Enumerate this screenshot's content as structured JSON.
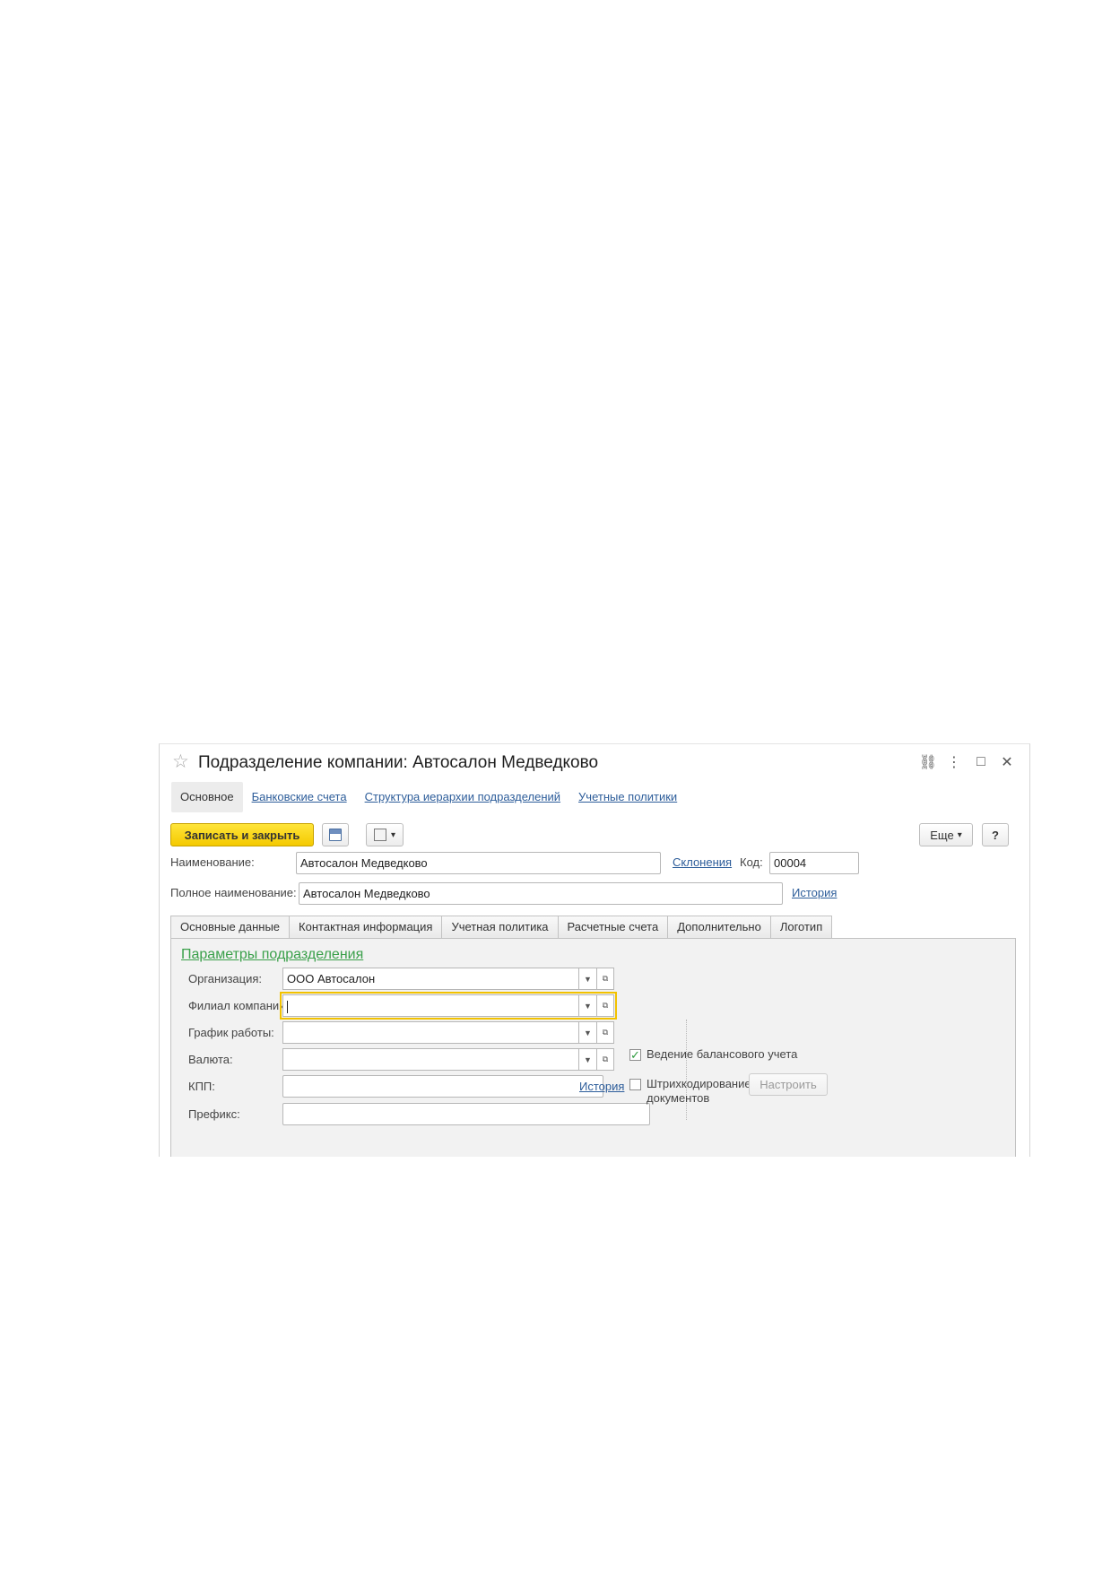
{
  "window": {
    "title": "Подразделение компании: Автосалон Медведково",
    "star_icon": "☆",
    "link_icon": "⛓",
    "more_icon": "⋮",
    "maximize_icon": "□",
    "close_icon": "✕"
  },
  "nav": {
    "items": [
      {
        "label": "Основное",
        "active": true
      },
      {
        "label": "Банковские счета",
        "active": false
      },
      {
        "label": "Структура иерархии подразделений",
        "active": false
      },
      {
        "label": "Учетные политики",
        "active": false
      }
    ]
  },
  "toolbar": {
    "save_close_label": "Записать и закрыть",
    "save_icon": "💾",
    "report_icon": "▣",
    "report_arrow": "▾",
    "more_label": "Еще",
    "more_arrow": "▾",
    "help_label": "?"
  },
  "header_fields": {
    "name_label": "Наименование:",
    "name_value": "Автосалон Медведково",
    "declension_link": "Склонения",
    "code_label": "Код:",
    "code_value": "00004",
    "fullname_label": "Полное наименование:",
    "fullname_value": "Автосалон Медведково",
    "history_link": "История"
  },
  "tabs": [
    {
      "label": "Основные данные",
      "active": true
    },
    {
      "label": "Контактная информация",
      "active": false
    },
    {
      "label": "Учетная политика",
      "active": false
    },
    {
      "label": "Расчетные счета",
      "active": false
    },
    {
      "label": "Дополнительно",
      "active": false
    },
    {
      "label": "Логотип",
      "active": false
    }
  ],
  "params": {
    "group_title": "Параметры подразделения",
    "org_label": "Организация:",
    "org_value": "ООО Автосалон",
    "branch_label": "Филиал компании:",
    "branch_value": "",
    "schedule_label": "График работы:",
    "schedule_value": "",
    "currency_label": "Валюта:",
    "currency_value": "",
    "kpp_label": "КПП:",
    "kpp_value": "",
    "kpp_history_link": "История",
    "prefix_label": "Префикс:",
    "prefix_value": "",
    "dropdown_arrow": "▼",
    "open_icon": "⧉"
  },
  "options": {
    "balance_label": "Ведение балансового учета",
    "balance_checked": true,
    "barcode_label_line1": "Штрихкодирование",
    "barcode_label_line2": "документов",
    "barcode_checked": false,
    "configure_label": "Настроить"
  }
}
